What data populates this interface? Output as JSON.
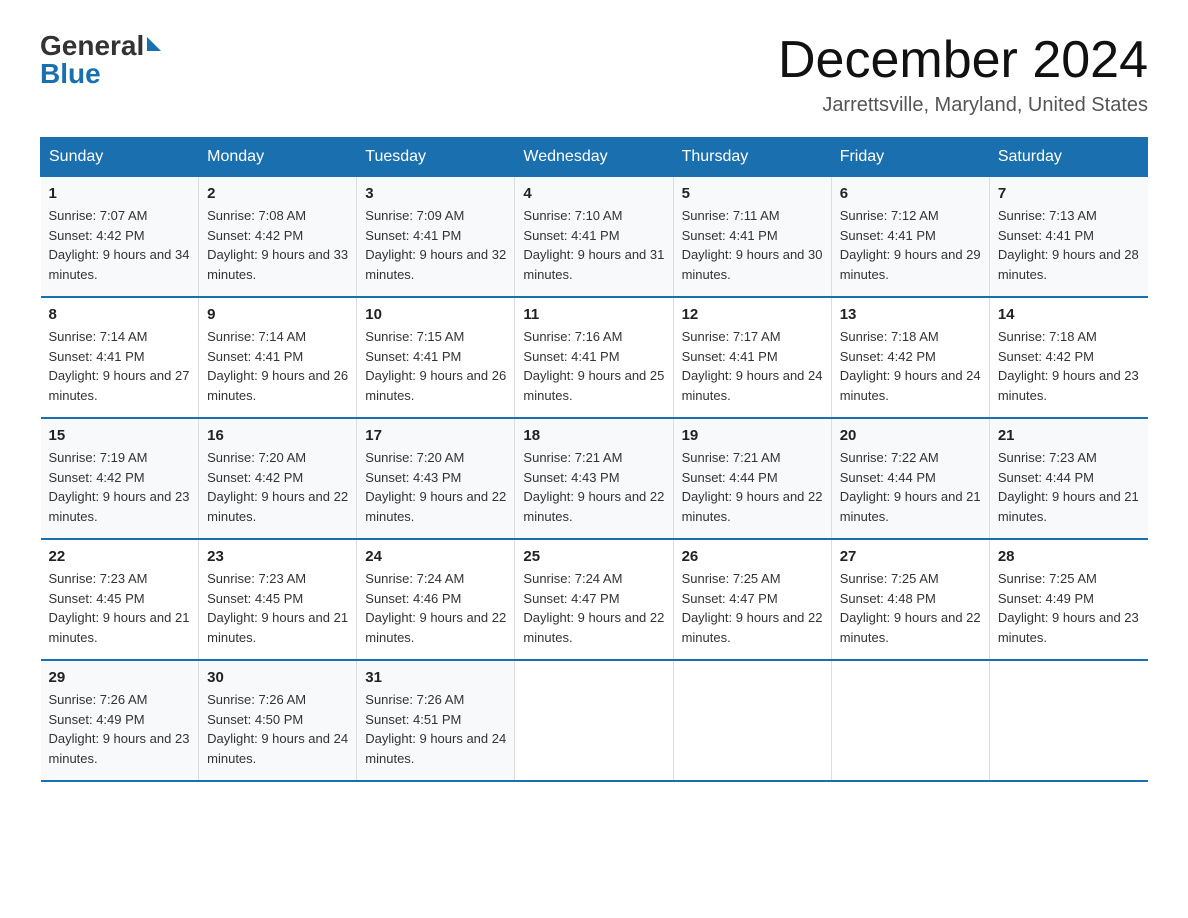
{
  "logo": {
    "general": "General",
    "blue": "Blue"
  },
  "header": {
    "title": "December 2024",
    "subtitle": "Jarrettsville, Maryland, United States"
  },
  "days_of_week": [
    "Sunday",
    "Monday",
    "Tuesday",
    "Wednesday",
    "Thursday",
    "Friday",
    "Saturday"
  ],
  "weeks": [
    [
      {
        "num": "1",
        "sunrise": "7:07 AM",
        "sunset": "4:42 PM",
        "daylight": "9 hours and 34 minutes."
      },
      {
        "num": "2",
        "sunrise": "7:08 AM",
        "sunset": "4:42 PM",
        "daylight": "9 hours and 33 minutes."
      },
      {
        "num": "3",
        "sunrise": "7:09 AM",
        "sunset": "4:41 PM",
        "daylight": "9 hours and 32 minutes."
      },
      {
        "num": "4",
        "sunrise": "7:10 AM",
        "sunset": "4:41 PM",
        "daylight": "9 hours and 31 minutes."
      },
      {
        "num": "5",
        "sunrise": "7:11 AM",
        "sunset": "4:41 PM",
        "daylight": "9 hours and 30 minutes."
      },
      {
        "num": "6",
        "sunrise": "7:12 AM",
        "sunset": "4:41 PM",
        "daylight": "9 hours and 29 minutes."
      },
      {
        "num": "7",
        "sunrise": "7:13 AM",
        "sunset": "4:41 PM",
        "daylight": "9 hours and 28 minutes."
      }
    ],
    [
      {
        "num": "8",
        "sunrise": "7:14 AM",
        "sunset": "4:41 PM",
        "daylight": "9 hours and 27 minutes."
      },
      {
        "num": "9",
        "sunrise": "7:14 AM",
        "sunset": "4:41 PM",
        "daylight": "9 hours and 26 minutes."
      },
      {
        "num": "10",
        "sunrise": "7:15 AM",
        "sunset": "4:41 PM",
        "daylight": "9 hours and 26 minutes."
      },
      {
        "num": "11",
        "sunrise": "7:16 AM",
        "sunset": "4:41 PM",
        "daylight": "9 hours and 25 minutes."
      },
      {
        "num": "12",
        "sunrise": "7:17 AM",
        "sunset": "4:41 PM",
        "daylight": "9 hours and 24 minutes."
      },
      {
        "num": "13",
        "sunrise": "7:18 AM",
        "sunset": "4:42 PM",
        "daylight": "9 hours and 24 minutes."
      },
      {
        "num": "14",
        "sunrise": "7:18 AM",
        "sunset": "4:42 PM",
        "daylight": "9 hours and 23 minutes."
      }
    ],
    [
      {
        "num": "15",
        "sunrise": "7:19 AM",
        "sunset": "4:42 PM",
        "daylight": "9 hours and 23 minutes."
      },
      {
        "num": "16",
        "sunrise": "7:20 AM",
        "sunset": "4:42 PM",
        "daylight": "9 hours and 22 minutes."
      },
      {
        "num": "17",
        "sunrise": "7:20 AM",
        "sunset": "4:43 PM",
        "daylight": "9 hours and 22 minutes."
      },
      {
        "num": "18",
        "sunrise": "7:21 AM",
        "sunset": "4:43 PM",
        "daylight": "9 hours and 22 minutes."
      },
      {
        "num": "19",
        "sunrise": "7:21 AM",
        "sunset": "4:44 PM",
        "daylight": "9 hours and 22 minutes."
      },
      {
        "num": "20",
        "sunrise": "7:22 AM",
        "sunset": "4:44 PM",
        "daylight": "9 hours and 21 minutes."
      },
      {
        "num": "21",
        "sunrise": "7:23 AM",
        "sunset": "4:44 PM",
        "daylight": "9 hours and 21 minutes."
      }
    ],
    [
      {
        "num": "22",
        "sunrise": "7:23 AM",
        "sunset": "4:45 PM",
        "daylight": "9 hours and 21 minutes."
      },
      {
        "num": "23",
        "sunrise": "7:23 AM",
        "sunset": "4:45 PM",
        "daylight": "9 hours and 21 minutes."
      },
      {
        "num": "24",
        "sunrise": "7:24 AM",
        "sunset": "4:46 PM",
        "daylight": "9 hours and 22 minutes."
      },
      {
        "num": "25",
        "sunrise": "7:24 AM",
        "sunset": "4:47 PM",
        "daylight": "9 hours and 22 minutes."
      },
      {
        "num": "26",
        "sunrise": "7:25 AM",
        "sunset": "4:47 PM",
        "daylight": "9 hours and 22 minutes."
      },
      {
        "num": "27",
        "sunrise": "7:25 AM",
        "sunset": "4:48 PM",
        "daylight": "9 hours and 22 minutes."
      },
      {
        "num": "28",
        "sunrise": "7:25 AM",
        "sunset": "4:49 PM",
        "daylight": "9 hours and 23 minutes."
      }
    ],
    [
      {
        "num": "29",
        "sunrise": "7:26 AM",
        "sunset": "4:49 PM",
        "daylight": "9 hours and 23 minutes."
      },
      {
        "num": "30",
        "sunrise": "7:26 AM",
        "sunset": "4:50 PM",
        "daylight": "9 hours and 24 minutes."
      },
      {
        "num": "31",
        "sunrise": "7:26 AM",
        "sunset": "4:51 PM",
        "daylight": "9 hours and 24 minutes."
      },
      null,
      null,
      null,
      null
    ]
  ]
}
